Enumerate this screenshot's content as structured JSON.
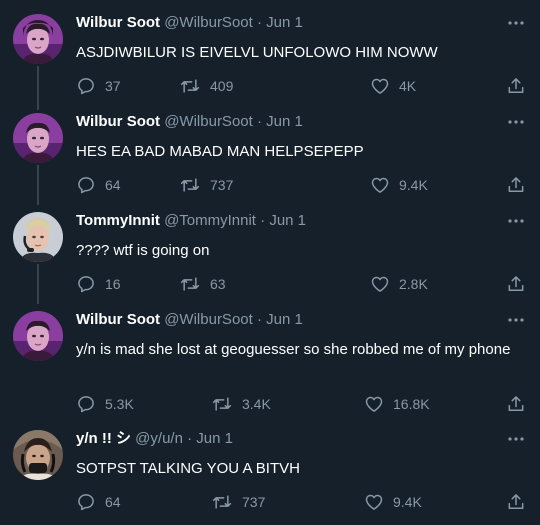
{
  "colors": {
    "background": "#15202b",
    "text": "#ffffff",
    "muted": "#8899a6",
    "thread_line": "#38444d"
  },
  "tweets": [
    {
      "name": "Wilbur Soot",
      "handle": "@WilburSoot",
      "separator": "·",
      "date": "Jun 1",
      "text": "ASJDIWBILUR IS EIVELVL UNFOLOWO HIM NOWW",
      "replies": "37",
      "retweets": "409",
      "likes": "4K",
      "avatar_icon": "avatar-wilbur-icon"
    },
    {
      "name": "Wilbur Soot",
      "handle": "@WilburSoot",
      "separator": "·",
      "date": "Jun 1",
      "text": "HES EA BAD MABAD MAN HELPSEPEPP",
      "replies": "64",
      "retweets": "737",
      "likes": "9.4K",
      "avatar_icon": "avatar-wilbur-icon"
    },
    {
      "name": "TommyInnit",
      "handle": "@TommyInnit",
      "separator": "·",
      "date": "Jun 1",
      "text": "???? wtf is going on",
      "replies": "16",
      "retweets": "63",
      "likes": "2.8K",
      "avatar_icon": "avatar-tommy-icon"
    },
    {
      "name": "Wilbur Soot",
      "handle": "@WilburSoot",
      "separator": "·",
      "date": "Jun 1",
      "text": "y/n is mad she lost at geoguesser so she robbed me of my phone",
      "replies": "5.3K",
      "retweets": "3.4K",
      "likes": "16.8K",
      "avatar_icon": "avatar-wilbur-icon"
    },
    {
      "name": "y/n !! シ",
      "handle": "@y/u/n",
      "separator": "·",
      "date": "Jun 1",
      "text": "SOTPST TALKING YOU A BITVH",
      "replies": "64",
      "retweets": "737",
      "likes": "9.4K",
      "avatar_icon": "avatar-yn-icon"
    }
  ],
  "icons": {
    "more": "more-horizontal-icon",
    "reply": "reply-icon",
    "retweet": "retweet-icon",
    "like": "heart-icon",
    "share": "share-icon"
  }
}
